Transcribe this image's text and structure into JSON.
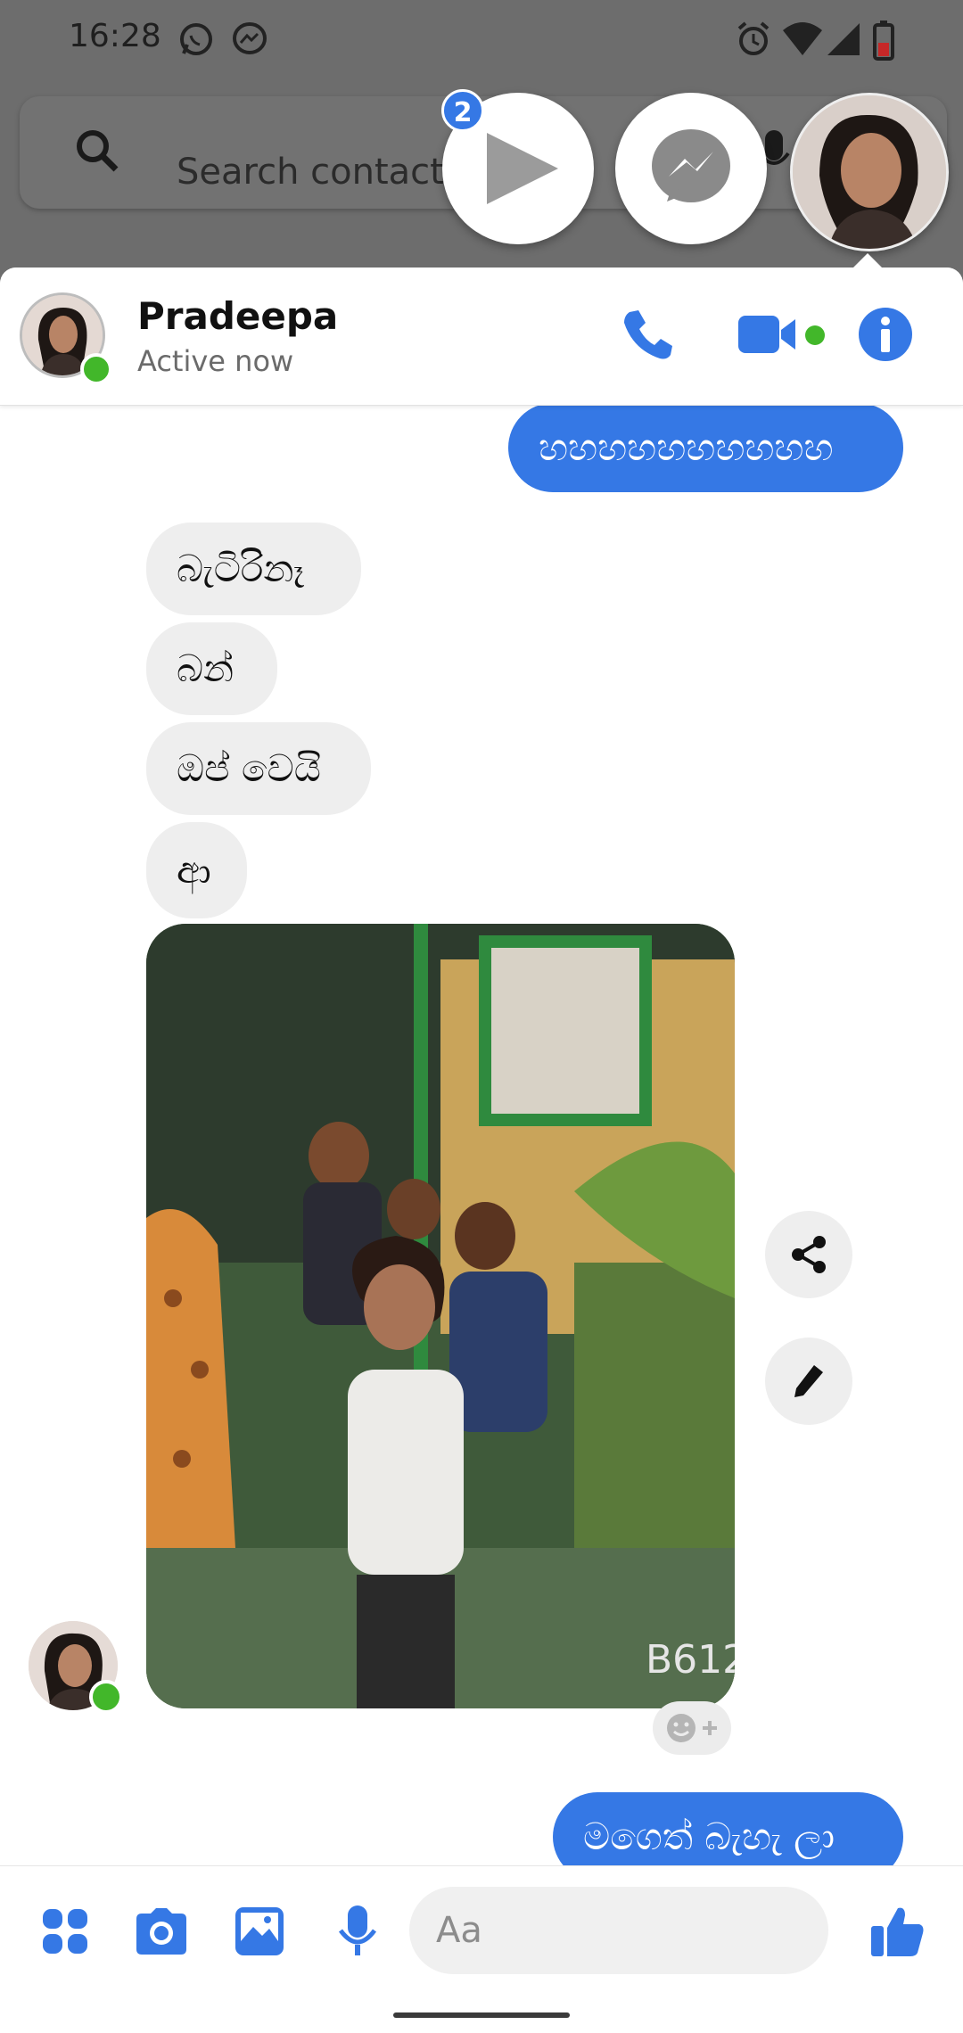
{
  "status_bar": {
    "time": "16:28",
    "left_icons": [
      "whatsapp-icon",
      "messenger-icon"
    ],
    "right_icons": [
      "alarm-icon",
      "wifi-icon",
      "signal-icon",
      "battery-icon"
    ]
  },
  "background_search": {
    "placeholder": "Search contacts"
  },
  "chat_heads": {
    "unread_badge": "2",
    "items": [
      "video-play-head",
      "messenger-head",
      "contact-head"
    ]
  },
  "chat": {
    "contact_name": "Pradeepa",
    "contact_status": "Active now",
    "header_actions": [
      "phone-icon",
      "video-camera-icon",
      "info-icon"
    ]
  },
  "messages": [
    {
      "direction": "outgoing",
      "text": "හහහහහහහහහහ"
    },
    {
      "direction": "incoming",
      "text": "බැටිරිනෑ"
    },
    {
      "direction": "incoming",
      "text": "බන්"
    },
    {
      "direction": "incoming",
      "text": "ඔප් වෙයි"
    },
    {
      "direction": "incoming",
      "text": "ආ"
    },
    {
      "direction": "incoming",
      "type": "photo",
      "watermark": "B612"
    },
    {
      "direction": "outgoing",
      "text": "මගෙත් බැහැ ලා"
    }
  ],
  "photo_actions": [
    "share-icon",
    "edit-pencil-icon"
  ],
  "composer": {
    "placeholder": "Aa",
    "icons": [
      "apps-icon",
      "camera-icon",
      "gallery-icon",
      "microphone-icon",
      "emoji-icon",
      "thumbs-up-icon"
    ]
  },
  "colors": {
    "accent": "#3578e5",
    "incoming_bubble": "#eeeeee",
    "online": "#42b72a",
    "dim_overlay": "#6d6d6d"
  }
}
